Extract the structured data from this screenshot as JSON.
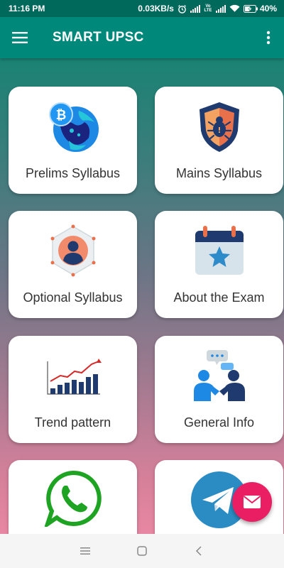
{
  "status_bar": {
    "time": "11:16 PM",
    "net_speed": "0.03KB/s",
    "volte": "Vo LTE",
    "battery": "40%"
  },
  "app_bar": {
    "title": "SMART UPSC",
    "menu_icon": "hamburger-menu-icon",
    "more_icon": "more-vertical-icon"
  },
  "cards": [
    {
      "label": "Prelims Syllabus",
      "icon": "bitcoin-globe-icon"
    },
    {
      "label": "Mains Syllabus",
      "icon": "shield-bug-icon"
    },
    {
      "label": "Optional Syllabus",
      "icon": "user-network-icon"
    },
    {
      "label": "About the Exam",
      "icon": "calendar-star-icon"
    },
    {
      "label": "Trend pattern",
      "icon": "bar-chart-trend-icon"
    },
    {
      "label": "General Info",
      "icon": "people-chat-icon"
    },
    {
      "label": "",
      "icon": "whatsapp-icon"
    },
    {
      "label": "",
      "icon": "telegram-icon"
    }
  ],
  "fab": {
    "icon": "mail-icon"
  },
  "colors": {
    "app_bar": "#00897b",
    "status_bar": "#00695c",
    "fab": "#e91e63",
    "gradient_top": "#1a8273",
    "gradient_bottom": "#e887a2"
  },
  "nav_bar": {
    "icons": [
      "recent-apps-icon",
      "home-icon",
      "back-icon"
    ]
  }
}
